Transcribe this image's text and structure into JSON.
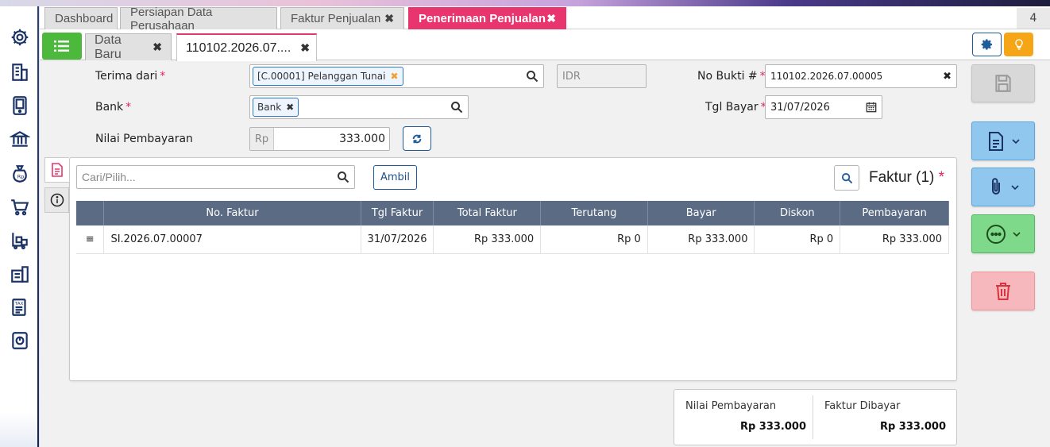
{
  "top_tabs": [
    {
      "label": "Dashboard",
      "closable": false,
      "active": false
    },
    {
      "label": "Persiapan Data Perusahaan",
      "closable": false,
      "active": false
    },
    {
      "label": "Faktur Penjualan",
      "closable": true,
      "active": false
    },
    {
      "label": "Penerimaan Penjualan",
      "closable": true,
      "active": true
    }
  ],
  "tab_count": "4",
  "sub_tabs": [
    {
      "label": "Data Baru",
      "active": false
    },
    {
      "label": "110102.2026.07....",
      "active": true
    }
  ],
  "form": {
    "terima_dari_label": "Terima dari",
    "terima_dari_value": "[C.00001] Pelanggan Tunai",
    "currency": "IDR",
    "bank_label": "Bank",
    "bank_value": "Bank",
    "nilai_label": "Nilai Pembayaran",
    "nilai_prefix": "Rp",
    "nilai_value": "333.000",
    "no_bukti_label": "No Bukti #",
    "no_bukti_value": "110102.2026.07.00005",
    "tgl_bayar_label": "Tgl Bayar",
    "tgl_bayar_value": "31/07/2026"
  },
  "panel": {
    "search_placeholder": "Cari/Pilih...",
    "ambil_label": "Ambil",
    "title": "Faktur (1)",
    "columns": [
      "No. Faktur",
      "Tgl Faktur",
      "Total Faktur",
      "Terutang",
      "Bayar",
      "Diskon",
      "Pembayaran"
    ],
    "rows": [
      {
        "no_faktur": "SI.2026.07.00007",
        "tgl_faktur": "31/07/2026",
        "total_faktur": "Rp 333.000",
        "terutang": "Rp 0",
        "bayar": "Rp 333.000",
        "diskon": "Rp 0",
        "pembayaran": "Rp 333.000"
      }
    ]
  },
  "summary": {
    "nilai_pembayaran_label": "Nilai Pembayaran",
    "nilai_pembayaran_value": "Rp 333.000",
    "faktur_dibayar_label": "Faktur Dibayar",
    "faktur_dibayar_value": "Rp 333.000"
  },
  "colors": {
    "accent_pink": "#e8356e",
    "menu_green": "#4cb83c",
    "table_header": "#5a6b83",
    "bulb_orange": "#f6a516",
    "navy": "#1f5c9b"
  },
  "sidebar_icons": [
    "settings-icon",
    "building-icon",
    "device-icon",
    "bank-icon",
    "money-bag-icon",
    "cart-icon",
    "purchase-icon",
    "warehouse-icon",
    "tax-icon",
    "report-icon"
  ]
}
